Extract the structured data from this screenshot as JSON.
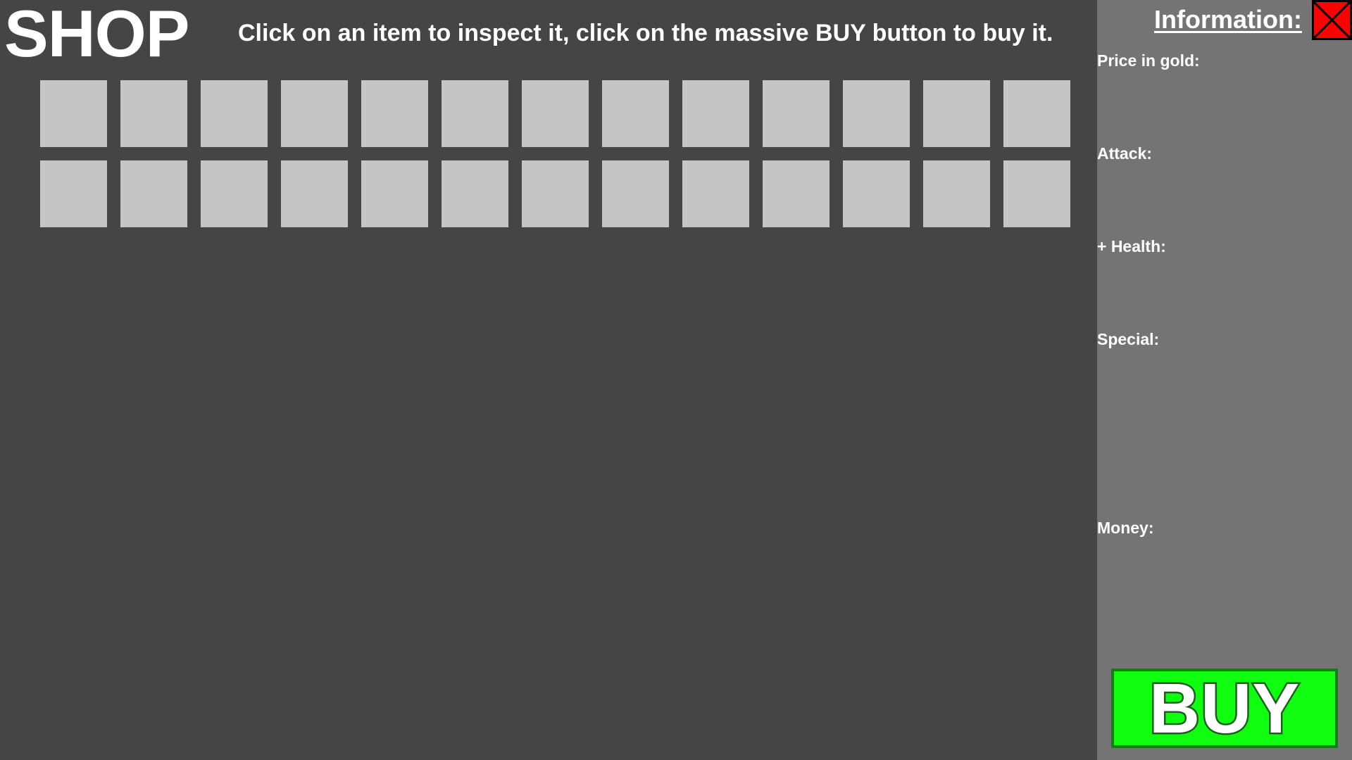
{
  "header": {
    "title": "SHOP",
    "instructions": "Click on an item to inspect it, click on the massive BUY button to buy it."
  },
  "item_grid": {
    "rows": 2,
    "columns": 13,
    "slot_color": "#c5c5c5"
  },
  "info_panel": {
    "title": "Information:",
    "close_icon": "close-x-icon",
    "close_color": "#ff0000",
    "labels": {
      "price": "Price in gold:",
      "attack": "Attack:",
      "health": "+ Health:",
      "special": "Special:",
      "money": "Money:"
    },
    "buy_label": "BUY",
    "buy_color": "#10ff10"
  },
  "colors": {
    "background": "#454545",
    "panel": "#747474",
    "text": "#ffffff"
  }
}
